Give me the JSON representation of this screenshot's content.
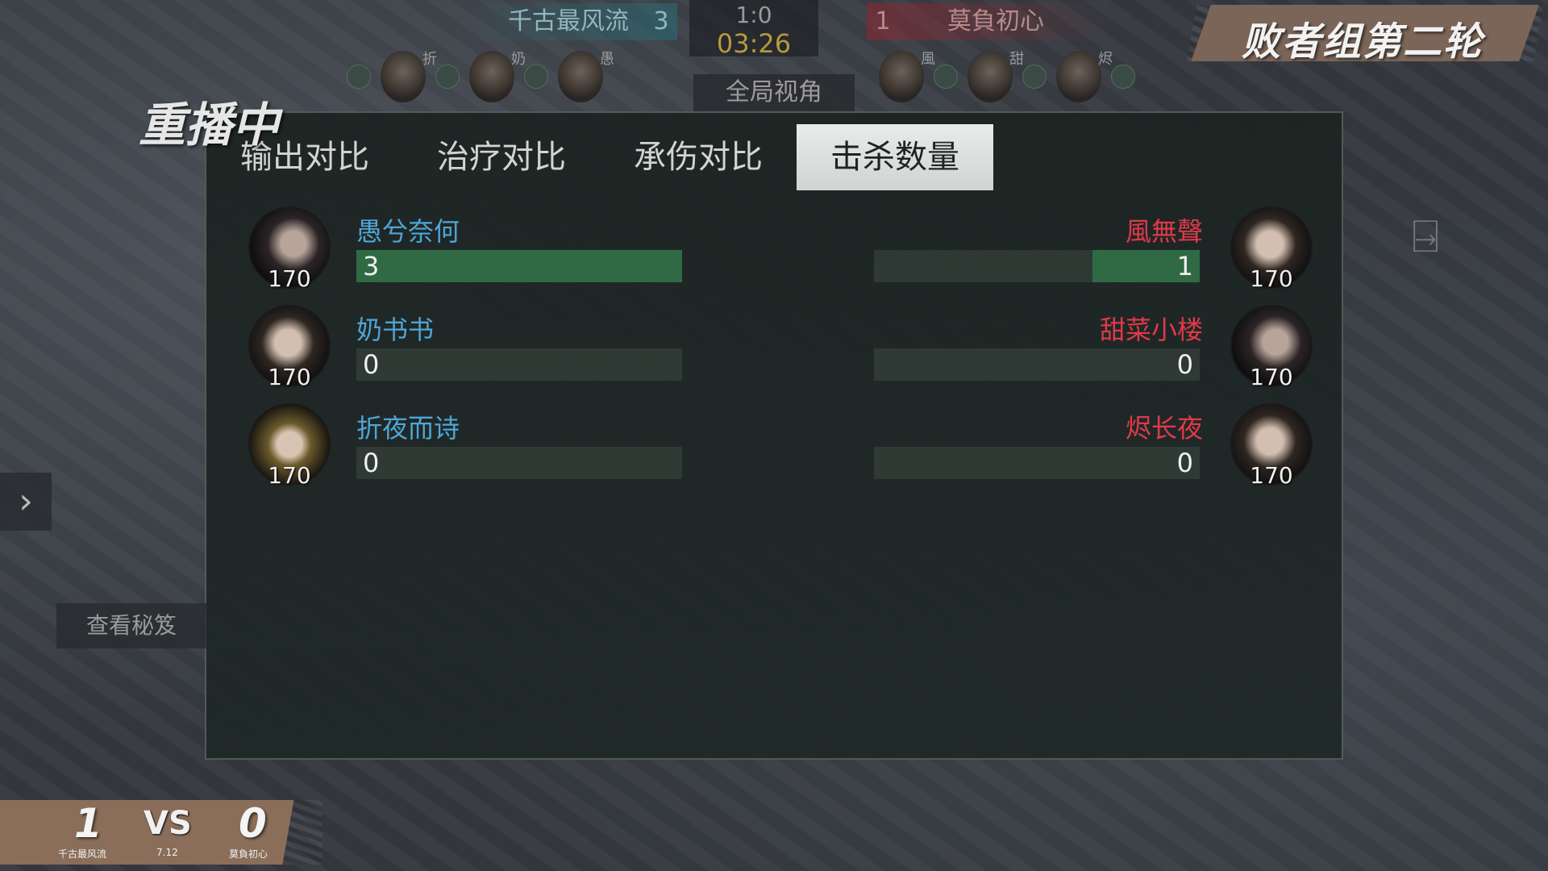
{
  "scoreboard_top": {
    "left_team": "千古最风流",
    "left_score": "3",
    "match_score": "1:0",
    "timer": "03:26",
    "right_score": "1",
    "right_team": "莫負初心",
    "observer_button": "全局视角",
    "left_mini_tags": [
      "折",
      "奶",
      "愚"
    ],
    "right_mini_tags": [
      "風",
      "甜",
      "烬"
    ]
  },
  "round_title": "败者组第二轮",
  "replay_label": "重播中",
  "tabs": [
    "输出对比",
    "治疗对比",
    "承伤对比",
    "击杀数量"
  ],
  "active_tab": 3,
  "rows": [
    {
      "left": {
        "name": "愚兮奈何",
        "level": "170",
        "value": 3,
        "value_text": "3",
        "fill": 1.0
      },
      "right": {
        "name": "風無聲",
        "level": "170",
        "value": 1,
        "value_text": "1",
        "fill": 0.33
      }
    },
    {
      "left": {
        "name": "奶书书",
        "level": "170",
        "value": 0,
        "value_text": "0",
        "fill": 0
      },
      "right": {
        "name": "甜菜小楼",
        "level": "170",
        "value": 0,
        "value_text": "0",
        "fill": 0
      }
    },
    {
      "left": {
        "name": "折夜而诗",
        "level": "170",
        "value": 0,
        "value_text": "0",
        "fill": 0
      },
      "right": {
        "name": "烬长夜",
        "level": "170",
        "value": 0,
        "value_text": "0",
        "fill": 0
      }
    }
  ],
  "cheat_button": "查看秘笈",
  "bottom_score": {
    "left_score": "1",
    "vs": "VS",
    "right_score": "0",
    "left_team": "千古最风流",
    "date": "7.12",
    "right_team": "莫負初心"
  },
  "colors": {
    "left_team": "#4fa6d6",
    "right_team": "#e0394a",
    "bar_fill": "#2f6a44",
    "timer": "#b79a3a"
  }
}
